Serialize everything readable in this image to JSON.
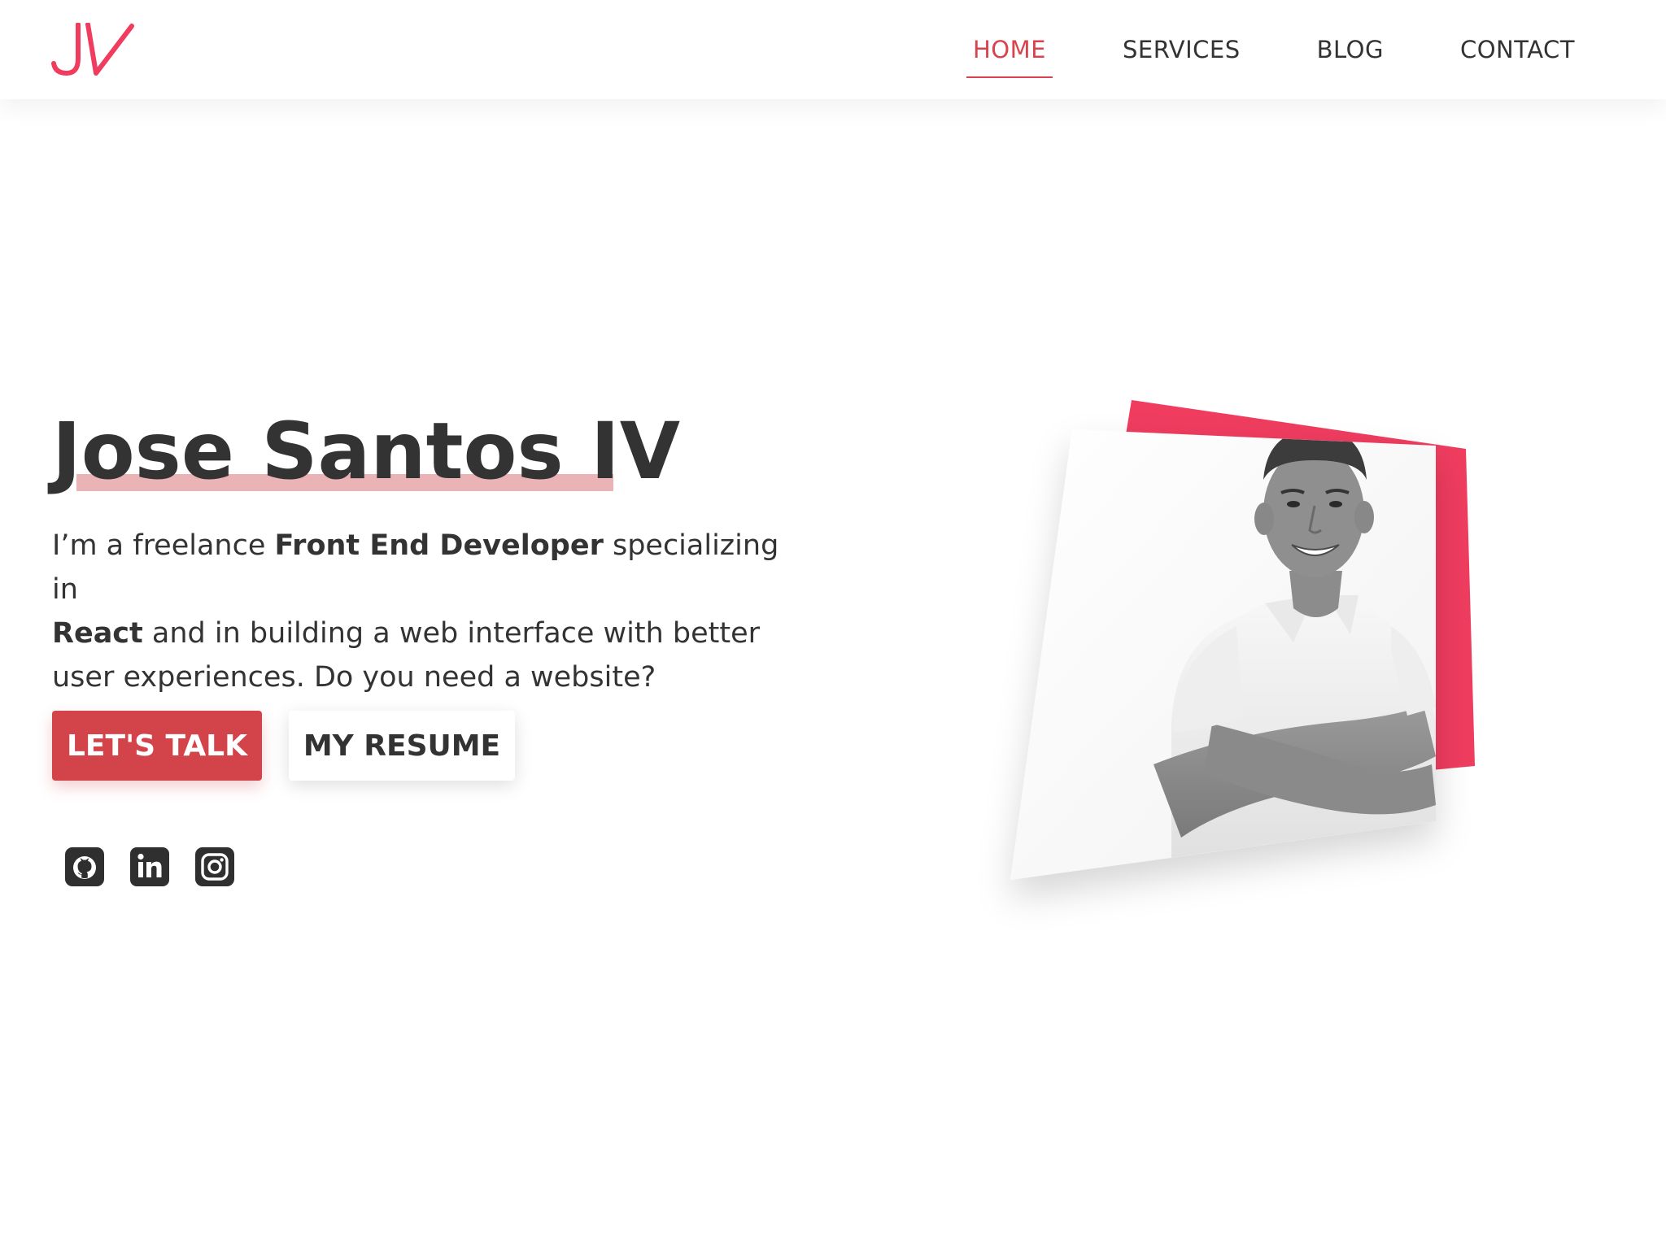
{
  "header": {
    "logo_text": "JV",
    "nav": [
      {
        "label": "HOME",
        "active": true
      },
      {
        "label": "SERVICES",
        "active": false
      },
      {
        "label": "BLOG",
        "active": false
      },
      {
        "label": "CONTACT",
        "active": false
      }
    ]
  },
  "hero": {
    "name": "Jose Santos IV",
    "desc_1": "I’m a freelance ",
    "desc_bold_1": "Front End Developer",
    "desc_2": " specializing in ",
    "desc_bold_2": "React",
    "desc_3": " and in building a web interface with better user experiences. Do you need a website?",
    "primary_button": "LET'S TALK",
    "secondary_button": "MY RESUME"
  },
  "social": [
    {
      "icon": "github-icon"
    },
    {
      "icon": "linkedin-icon"
    },
    {
      "icon": "instagram-icon"
    }
  ],
  "colors": {
    "accent": "#d9434d",
    "brand_pink": "#ef3c5f",
    "button_red": "#d2444a",
    "name_highlight": "#eab3b6",
    "text": "#333333"
  }
}
